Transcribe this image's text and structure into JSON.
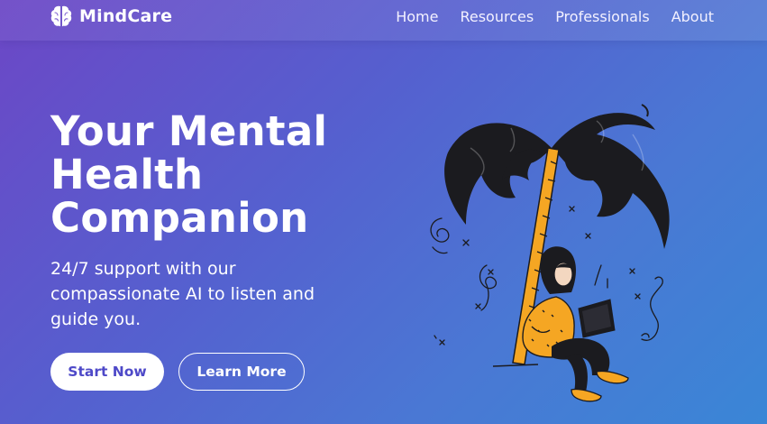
{
  "nav": {
    "brand": "MindCare",
    "links": [
      "Home",
      "Resources",
      "Professionals",
      "About"
    ]
  },
  "hero": {
    "title_line1": "Your Mental",
    "title_line2": "Health",
    "title_line3": "Companion",
    "subtitle": "24/7 support with our compassionate AI to listen and guide you.",
    "primary_button": "Start Now",
    "secondary_button": "Learn More"
  },
  "icons": {
    "brand": "brain-icon",
    "illustration": "woman-under-palm-tree-with-laptop"
  },
  "colors": {
    "gradient_start": "#6c47c6",
    "gradient_end": "#3a86d6",
    "primary_button_text": "#4e49c8",
    "accent_orange": "#f5a623"
  }
}
